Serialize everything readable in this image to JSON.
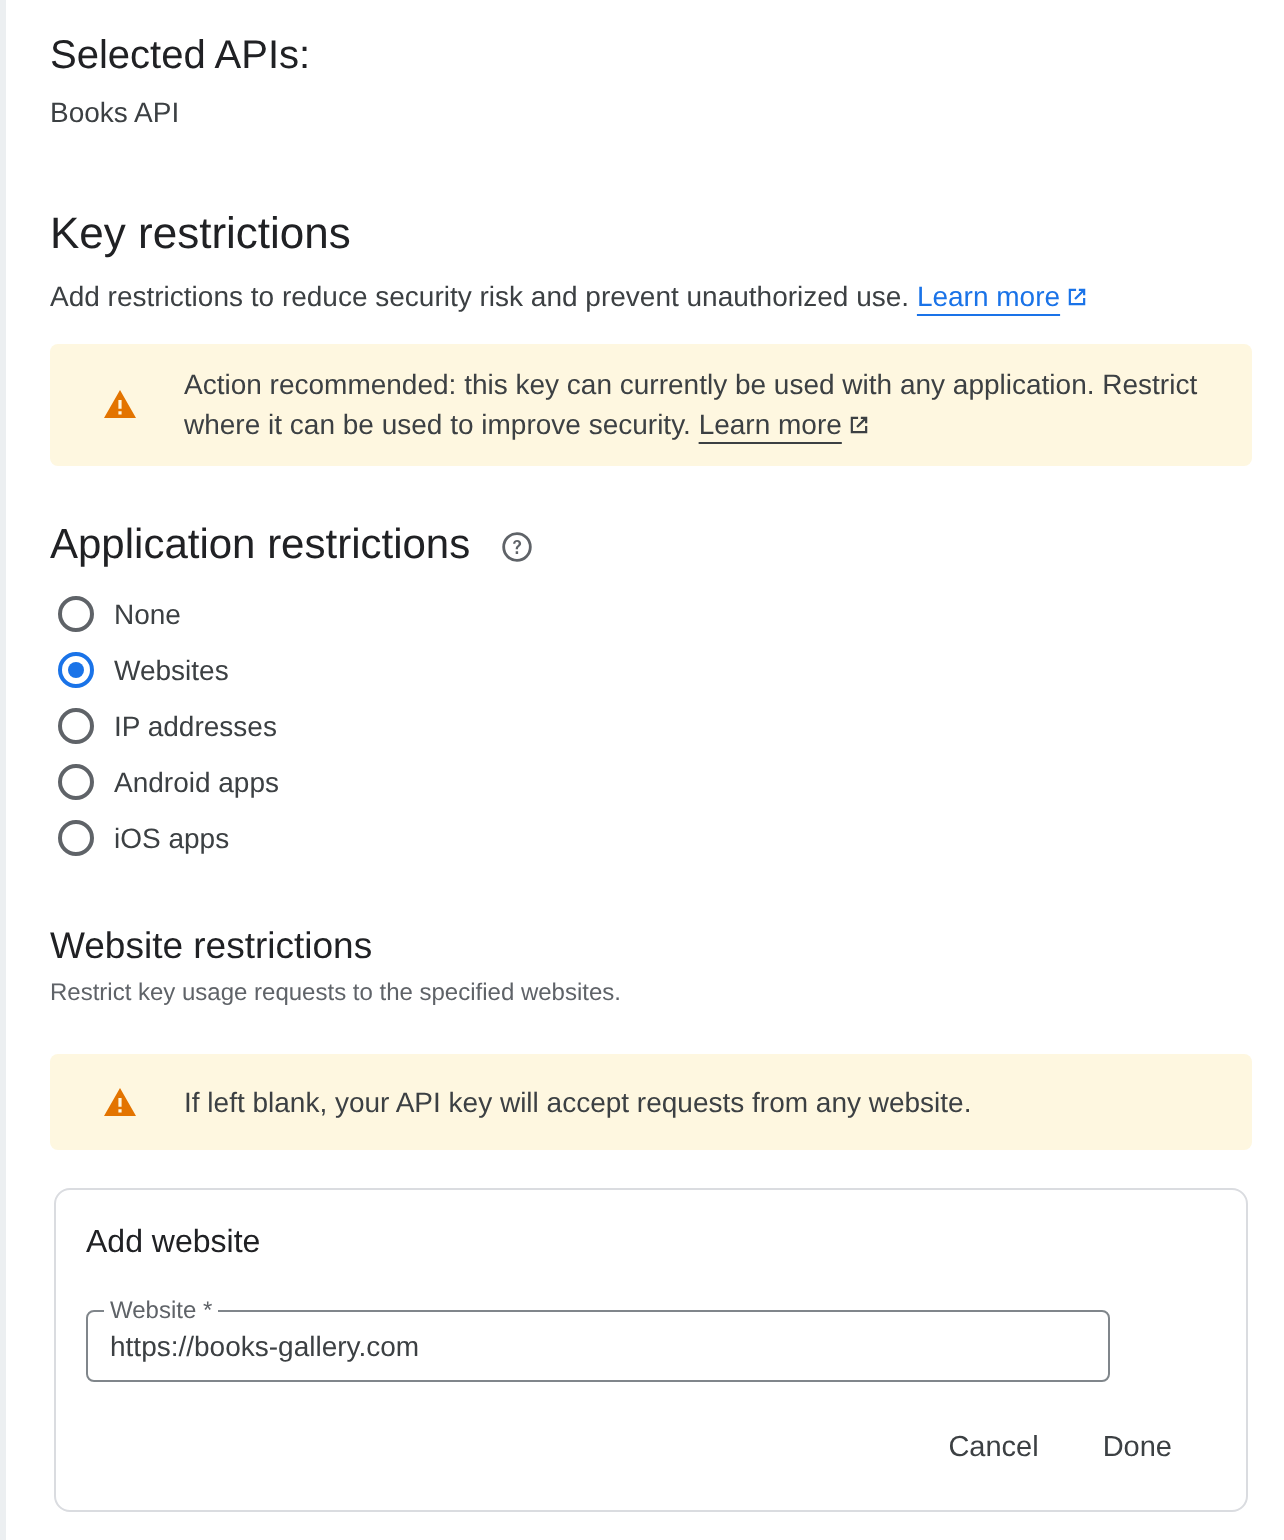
{
  "selected_apis": {
    "title": "Selected APIs:",
    "items": [
      "Books API"
    ]
  },
  "key_restrictions": {
    "title": "Key restrictions",
    "description": "Add restrictions to reduce security risk and prevent unauthorized use.",
    "link": "Learn more",
    "alert": {
      "text": "Action recommended: this key can currently be used with any application. Restrict where it can be used to improve security.",
      "link": "Learn more"
    }
  },
  "application_restrictions": {
    "title": "Application restrictions",
    "options": [
      {
        "label": "None",
        "selected": false
      },
      {
        "label": "Websites",
        "selected": true
      },
      {
        "label": "IP addresses",
        "selected": false
      },
      {
        "label": "Android apps",
        "selected": false
      },
      {
        "label": "iOS apps",
        "selected": false
      }
    ]
  },
  "website_restrictions": {
    "title": "Website restrictions",
    "description": "Restrict key usage requests to the specified websites.",
    "alert": {
      "text": "If left blank, your API key will accept requests from any website."
    },
    "add_website": {
      "title": "Add website",
      "field": {
        "label": "Website *",
        "value": "https://books-gallery.com"
      },
      "buttons": [
        "Cancel",
        "Done"
      ]
    }
  }
}
